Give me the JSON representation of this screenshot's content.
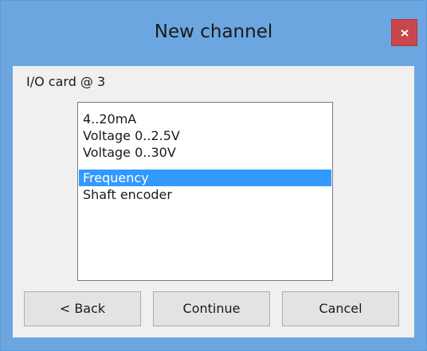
{
  "window": {
    "title": "New channel",
    "title_bar_color": "#6ba6e0",
    "close_button_color": "#c9464a",
    "close_icon": "close-icon"
  },
  "dialog": {
    "card_label": "I/O card @ 3",
    "list": {
      "items": [
        {
          "label": "4..20mA",
          "selected": false
        },
        {
          "label": "Voltage 0..2.5V",
          "selected": false
        },
        {
          "label": "Voltage 0..30V",
          "selected": false
        },
        {
          "label": "Frequency",
          "selected": true
        },
        {
          "label": "Shaft encoder",
          "selected": false
        }
      ],
      "selection_color": "#3399ff"
    },
    "buttons": {
      "back": "< Back",
      "continue": "Continue",
      "cancel": "Cancel"
    }
  }
}
